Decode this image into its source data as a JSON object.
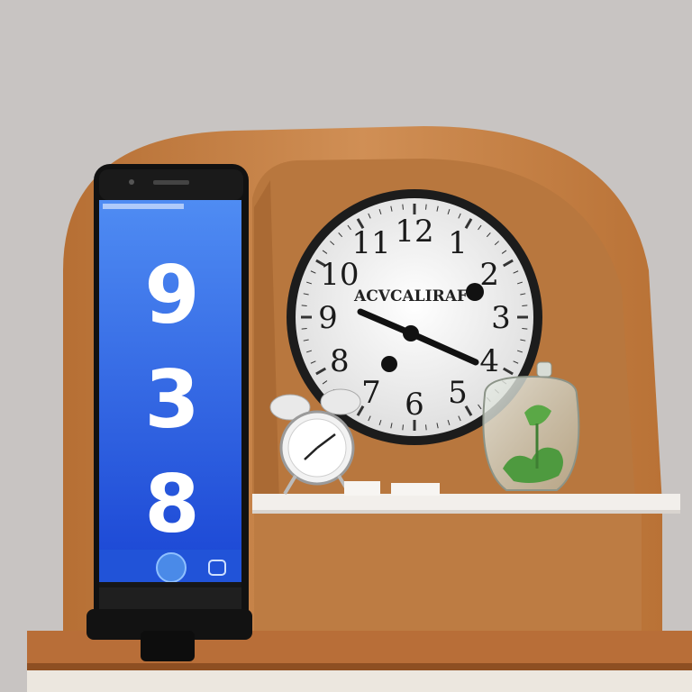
{
  "phone": {
    "digits": [
      "9",
      "3",
      "8"
    ],
    "screen_color_top": "#2f6fe8",
    "screen_color_bottom": "#1d49d8"
  },
  "wall_clock": {
    "brand": "ACVCALIRAF",
    "numerals": [
      "12",
      "1",
      "2",
      "3",
      "4",
      "5",
      "6",
      "7",
      "8",
      "9",
      "10",
      "11"
    ]
  },
  "colors": {
    "wall": "#c9c5c3",
    "wood": "#c98547",
    "wood_dark": "#a86530",
    "shelf": "#f1eeea",
    "clock_frame": "#1d1d1d"
  }
}
